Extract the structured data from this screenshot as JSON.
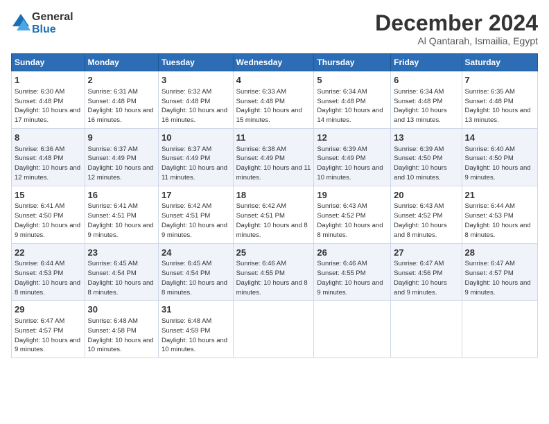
{
  "logo": {
    "line1": "General",
    "line2": "Blue"
  },
  "title": "December 2024",
  "subtitle": "Al Qantarah, Ismailia, Egypt",
  "days_of_week": [
    "Sunday",
    "Monday",
    "Tuesday",
    "Wednesday",
    "Thursday",
    "Friday",
    "Saturday"
  ],
  "weeks": [
    [
      {
        "num": "1",
        "sunrise": "6:30 AM",
        "sunset": "4:48 PM",
        "daylight": "10 hours and 17 minutes."
      },
      {
        "num": "2",
        "sunrise": "6:31 AM",
        "sunset": "4:48 PM",
        "daylight": "10 hours and 16 minutes."
      },
      {
        "num": "3",
        "sunrise": "6:32 AM",
        "sunset": "4:48 PM",
        "daylight": "10 hours and 16 minutes."
      },
      {
        "num": "4",
        "sunrise": "6:33 AM",
        "sunset": "4:48 PM",
        "daylight": "10 hours and 15 minutes."
      },
      {
        "num": "5",
        "sunrise": "6:34 AM",
        "sunset": "4:48 PM",
        "daylight": "10 hours and 14 minutes."
      },
      {
        "num": "6",
        "sunrise": "6:34 AM",
        "sunset": "4:48 PM",
        "daylight": "10 hours and 13 minutes."
      },
      {
        "num": "7",
        "sunrise": "6:35 AM",
        "sunset": "4:48 PM",
        "daylight": "10 hours and 13 minutes."
      }
    ],
    [
      {
        "num": "8",
        "sunrise": "6:36 AM",
        "sunset": "4:48 PM",
        "daylight": "10 hours and 12 minutes."
      },
      {
        "num": "9",
        "sunrise": "6:37 AM",
        "sunset": "4:49 PM",
        "daylight": "10 hours and 12 minutes."
      },
      {
        "num": "10",
        "sunrise": "6:37 AM",
        "sunset": "4:49 PM",
        "daylight": "10 hours and 11 minutes."
      },
      {
        "num": "11",
        "sunrise": "6:38 AM",
        "sunset": "4:49 PM",
        "daylight": "10 hours and 11 minutes."
      },
      {
        "num": "12",
        "sunrise": "6:39 AM",
        "sunset": "4:49 PM",
        "daylight": "10 hours and 10 minutes."
      },
      {
        "num": "13",
        "sunrise": "6:39 AM",
        "sunset": "4:50 PM",
        "daylight": "10 hours and 10 minutes."
      },
      {
        "num": "14",
        "sunrise": "6:40 AM",
        "sunset": "4:50 PM",
        "daylight": "10 hours and 9 minutes."
      }
    ],
    [
      {
        "num": "15",
        "sunrise": "6:41 AM",
        "sunset": "4:50 PM",
        "daylight": "10 hours and 9 minutes."
      },
      {
        "num": "16",
        "sunrise": "6:41 AM",
        "sunset": "4:51 PM",
        "daylight": "10 hours and 9 minutes."
      },
      {
        "num": "17",
        "sunrise": "6:42 AM",
        "sunset": "4:51 PM",
        "daylight": "10 hours and 9 minutes."
      },
      {
        "num": "18",
        "sunrise": "6:42 AM",
        "sunset": "4:51 PM",
        "daylight": "10 hours and 8 minutes."
      },
      {
        "num": "19",
        "sunrise": "6:43 AM",
        "sunset": "4:52 PM",
        "daylight": "10 hours and 8 minutes."
      },
      {
        "num": "20",
        "sunrise": "6:43 AM",
        "sunset": "4:52 PM",
        "daylight": "10 hours and 8 minutes."
      },
      {
        "num": "21",
        "sunrise": "6:44 AM",
        "sunset": "4:53 PM",
        "daylight": "10 hours and 8 minutes."
      }
    ],
    [
      {
        "num": "22",
        "sunrise": "6:44 AM",
        "sunset": "4:53 PM",
        "daylight": "10 hours and 8 minutes."
      },
      {
        "num": "23",
        "sunrise": "6:45 AM",
        "sunset": "4:54 PM",
        "daylight": "10 hours and 8 minutes."
      },
      {
        "num": "24",
        "sunrise": "6:45 AM",
        "sunset": "4:54 PM",
        "daylight": "10 hours and 8 minutes."
      },
      {
        "num": "25",
        "sunrise": "6:46 AM",
        "sunset": "4:55 PM",
        "daylight": "10 hours and 8 minutes."
      },
      {
        "num": "26",
        "sunrise": "6:46 AM",
        "sunset": "4:55 PM",
        "daylight": "10 hours and 9 minutes."
      },
      {
        "num": "27",
        "sunrise": "6:47 AM",
        "sunset": "4:56 PM",
        "daylight": "10 hours and 9 minutes."
      },
      {
        "num": "28",
        "sunrise": "6:47 AM",
        "sunset": "4:57 PM",
        "daylight": "10 hours and 9 minutes."
      }
    ],
    [
      {
        "num": "29",
        "sunrise": "6:47 AM",
        "sunset": "4:57 PM",
        "daylight": "10 hours and 9 minutes."
      },
      {
        "num": "30",
        "sunrise": "6:48 AM",
        "sunset": "4:58 PM",
        "daylight": "10 hours and 10 minutes."
      },
      {
        "num": "31",
        "sunrise": "6:48 AM",
        "sunset": "4:59 PM",
        "daylight": "10 hours and 10 minutes."
      },
      null,
      null,
      null,
      null
    ]
  ]
}
